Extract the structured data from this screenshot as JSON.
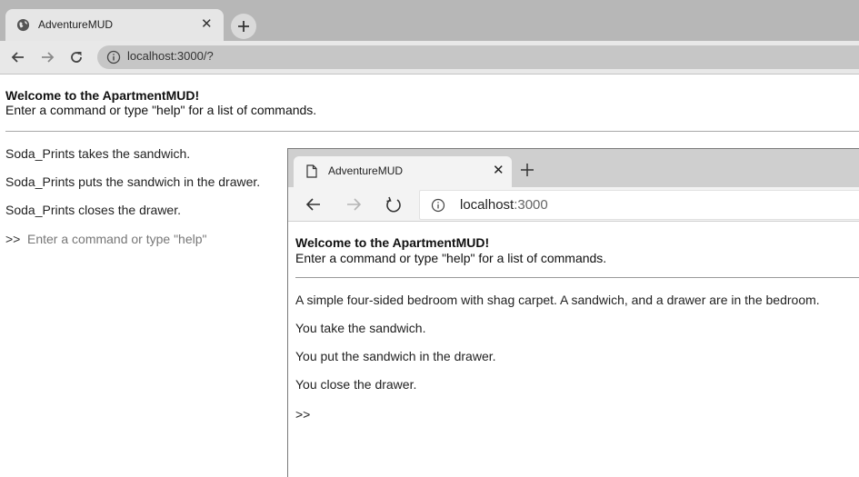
{
  "back_browser": {
    "tab_title": "AdventureMUD",
    "url": "localhost:3000/?",
    "heading": "Welcome to the ApartmentMUD!",
    "subheading": "Enter a command or type \"help\" for a list of commands.",
    "log": [
      "Soda_Prints takes the sandwich.",
      "Soda_Prints puts the sandwich in the drawer.",
      "Soda_Prints closes the drawer."
    ],
    "prompt": ">>",
    "input_placeholder": "Enter a command or type \"help\"",
    "input_value": ""
  },
  "front_browser": {
    "tab_title": "AdventureMUD",
    "url_host": "localhost",
    "url_port": ":3000",
    "heading": "Welcome to the ApartmentMUD!",
    "subheading": "Enter a command or type \"help\" for a list of commands.",
    "log": [
      "A simple four-sided bedroom with shag carpet. A sandwich, and a drawer are in the bedroom.",
      "You take the sandwich.",
      "You put the sandwich in the drawer.",
      "You close the drawer."
    ],
    "prompt": ">>",
    "input_value": ""
  },
  "icons": {
    "back": "back-arrow-icon",
    "forward": "forward-arrow-icon",
    "reload": "reload-icon",
    "info": "info-icon",
    "close": "close-icon",
    "new_tab": "plus-icon",
    "globe": "globe-icon",
    "page": "page-icon"
  },
  "colors": {
    "back_tabstrip": "#b7b7b7",
    "back_toolbar": "#e8e8e8",
    "front_tabstrip": "#cfcfcf",
    "front_toolbar": "#f3f3f3"
  }
}
